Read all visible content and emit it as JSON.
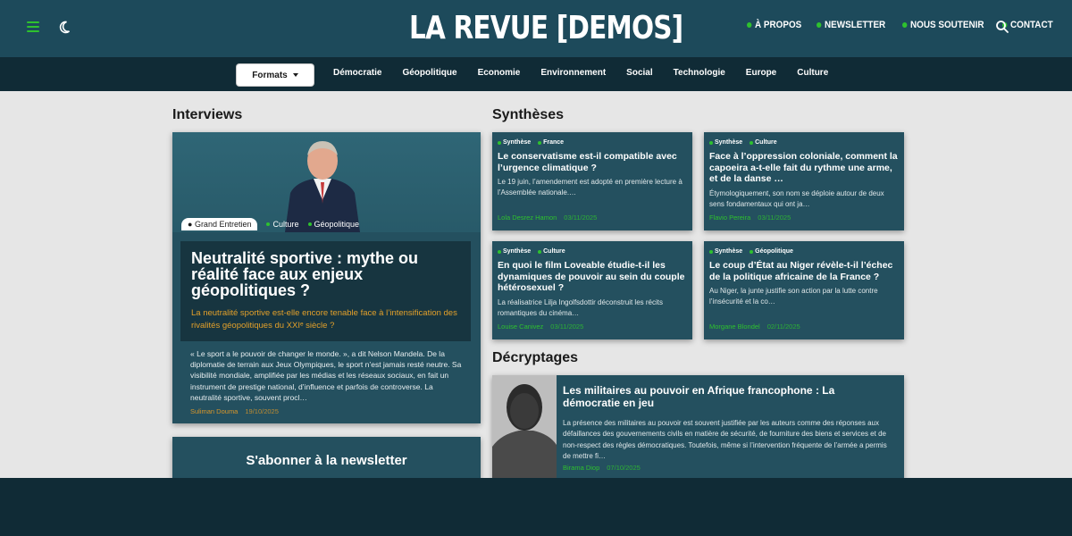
{
  "header": {
    "logo_text": "LA REVUE [DEMOS]",
    "nav": [
      {
        "label": "À PROPOS"
      },
      {
        "label": "NEWSLETTER"
      },
      {
        "label": "NOUS SOUTENIR"
      },
      {
        "label": "CONTACT"
      }
    ],
    "icons": {
      "menu": "hamburger-icon",
      "theme": "moon-icon",
      "search": "search-icon"
    }
  },
  "categories": {
    "formats_label": "Formats",
    "items": [
      "Démocratie",
      "Géopolitique",
      "Economie",
      "Environnement",
      "Social",
      "Technologie",
      "Europe",
      "Culture"
    ]
  },
  "interviews": {
    "section_title": "Interviews",
    "card": {
      "tag_format": "Grand Entretien",
      "tags": [
        "Culture",
        "Géopolitique"
      ],
      "title": "Neutralité sportive : mythe ou réalité face aux enjeux géopolitiques ?",
      "subtitle": "La neutralité sportive est-elle encore tenable face à l’intensification des rivalités géopolitiques du XXIᵉ siècle ?",
      "excerpt": "« Le sport a le pouvoir de changer le monde. », a dit Nelson Mandela. De la diplomatie de terrain aux Jeux Olympiques, le sport n’est jamais resté neutre. Sa visibilité mondiale, amplifiée par les médias et les réseaux sociaux, en fait un instrument de prestige national, d’influence et parfois de controverse. La neutralité sportive, souvent procl…",
      "author": "Suliman Douma",
      "date": "19/10/2025"
    }
  },
  "newsletter": {
    "title": "S'abonner à la newsletter"
  },
  "syntheses": {
    "section_title": "Synthèses",
    "cards": [
      {
        "tags": [
          "Synthèse",
          "France"
        ],
        "title": "Le conservatisme est-il compatible avec l’urgence climatique ?",
        "excerpt": "Le 19 juin, l’amendement est adopté en première lecture à l’Assemblée nationale.…",
        "author": "Lola Desrez Hamon",
        "date": "03/11/2025"
      },
      {
        "tags": [
          "Synthèse",
          "Culture"
        ],
        "title": "Face à l’oppression coloniale, comment la capoeira a-t-elle fait du rythme une arme, et de la danse …",
        "excerpt": "Étymologiquement, son nom se déploie autour de deux sens fondamentaux qui ont ja…",
        "author": "Flavio Pereira",
        "date": "03/11/2025"
      },
      {
        "tags": [
          "Synthèse",
          "Culture"
        ],
        "title": "En quoi le film Loveable étudie-t-il les dynamiques de pouvoir au sein du couple hétérosexuel ?",
        "excerpt": "La réalisatrice Lilja Ingolfsdottir déconstruit les récits romantiques du cinéma…",
        "author": "Louise Canivez",
        "date": "03/11/2025"
      },
      {
        "tags": [
          "Synthèse",
          "Géopolitique"
        ],
        "title": "Le coup d’État au Niger révèle-t-il l’échec de la politique africaine de la France ?",
        "excerpt": "Au Niger, la junte justifie son action par la lutte contre l’insécurité et la co…",
        "author": "Morgane Blondel",
        "date": "02/11/2025"
      }
    ]
  },
  "decryptages": {
    "section_title": "Décryptages",
    "card": {
      "title": "Les militaires au pouvoir en Afrique francophone : La démocratie en jeu",
      "excerpt": "La présence des militaires au pouvoir est souvent justifiée par les auteurs comme des réponses aux défaillances des gouvernements civils en matière de sécurité, de fourniture des biens et services et de non-respect des règles démocratiques. Toutefois, même si l’intervention fréquente de l’armée a permis de mettre fi…",
      "author": "Birama Diop",
      "date": "07/10/2025"
    }
  }
}
